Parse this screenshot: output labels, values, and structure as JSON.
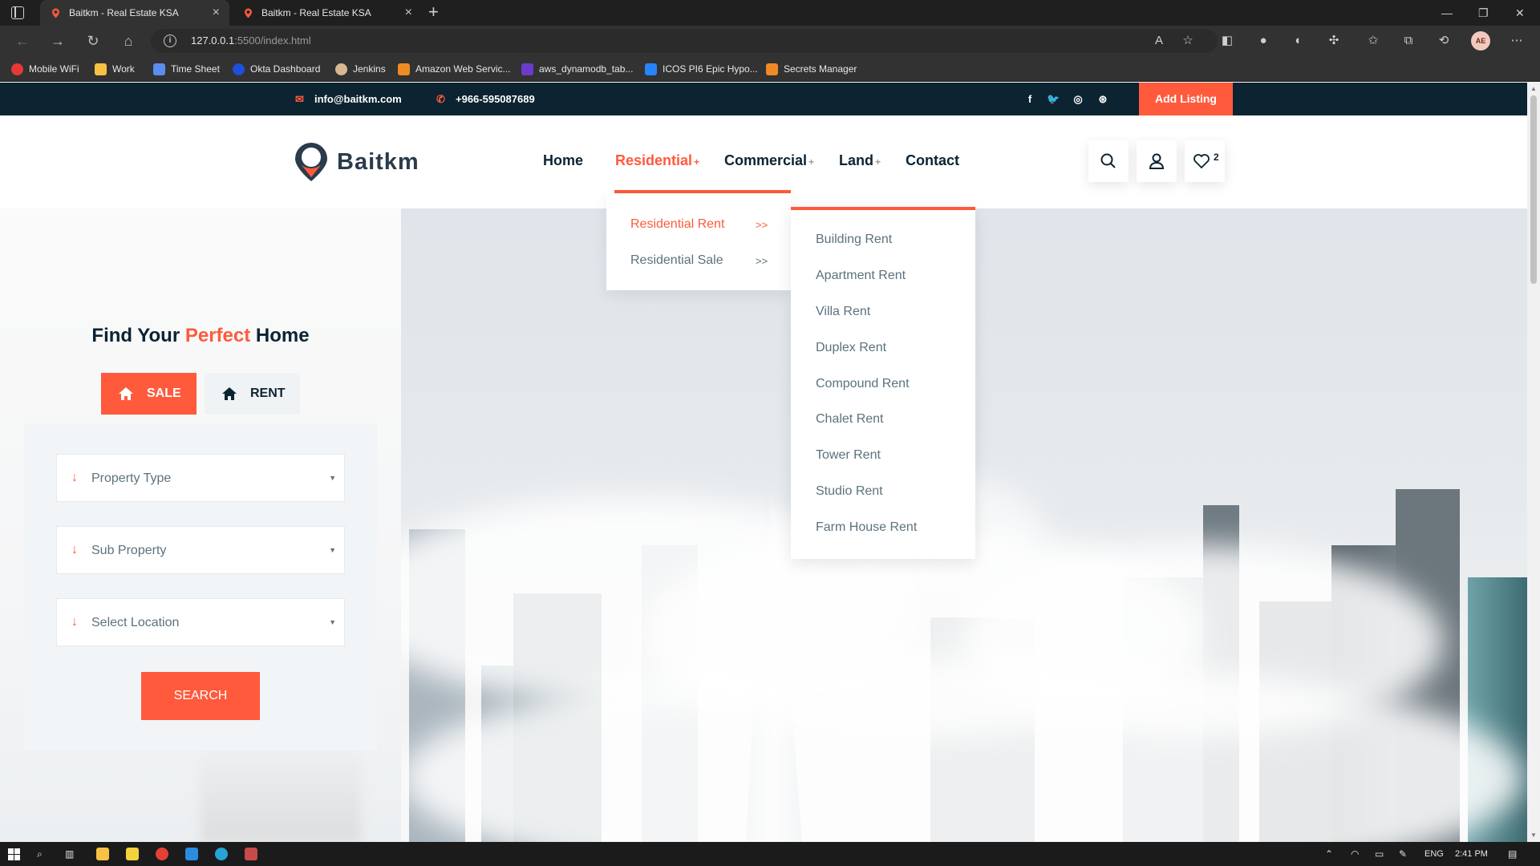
{
  "browser": {
    "tabs": [
      {
        "title": "Baitkm - Real Estate KSA",
        "active": true
      },
      {
        "title": "Baitkm - Real Estate KSA",
        "active": false
      }
    ],
    "url_host": "127.0.0.1",
    "url_rest": ":5500/index.html",
    "avatar_initials": "AE",
    "bookmarks": [
      {
        "label": "Mobile WiFi",
        "color": "#e53935"
      },
      {
        "label": "Work",
        "color": "#f6c244"
      },
      {
        "label": "Time Sheet",
        "color": "#5b8def"
      },
      {
        "label": "Okta Dashboard",
        "color": "#1d4fd8"
      },
      {
        "label": "Jenkins",
        "color": "#d8b892"
      },
      {
        "label": "Amazon Web Servic...",
        "color": "#f08a24"
      },
      {
        "label": "aws_dynamodb_tab...",
        "color": "#6a3cc9"
      },
      {
        "label": "ICOS PI6 Epic Hypo...",
        "color": "#2684ff"
      },
      {
        "label": "Secrets Manager",
        "color": "#f08a24"
      }
    ]
  },
  "site": {
    "topbar": {
      "email": "info@baitkm.com",
      "phone": "+966-595087689",
      "add_listing": "Add Listing"
    },
    "logo_text": "Baitkm",
    "nav": [
      {
        "label": "Home",
        "has_sub": false
      },
      {
        "label": "Residential",
        "has_sub": true
      },
      {
        "label": "Commercial",
        "has_sub": true
      },
      {
        "label": "Land",
        "has_sub": true
      },
      {
        "label": "Contact",
        "has_sub": false
      }
    ],
    "plus_symbol": "+",
    "favorites_count": "2",
    "residential_menu": [
      {
        "label": "Residential Rent",
        "chevron": ">>"
      },
      {
        "label": "Residential Sale",
        "chevron": ">>"
      }
    ],
    "rent_submenu": [
      "Building Rent",
      "Apartment Rent",
      "Villa Rent",
      "Duplex Rent",
      "Compound Rent",
      "Chalet Rent",
      "Tower Rent",
      "Studio Rent",
      "Farm House Rent"
    ],
    "search_panel": {
      "title_part1": "Find Your",
      "title_highlight": "Perfect",
      "title_part2": "Home",
      "tab_sale": "SALE",
      "tab_rent": "RENT",
      "field_property_type": "Property Type",
      "field_sub_property": "Sub Property",
      "field_location": "Select Location",
      "search_button": "SEARCH"
    },
    "accent_color": "#ff5a3c",
    "dark_color": "#0c2331"
  },
  "taskbar": {
    "language": "ENG",
    "time": "2:41 PM"
  }
}
